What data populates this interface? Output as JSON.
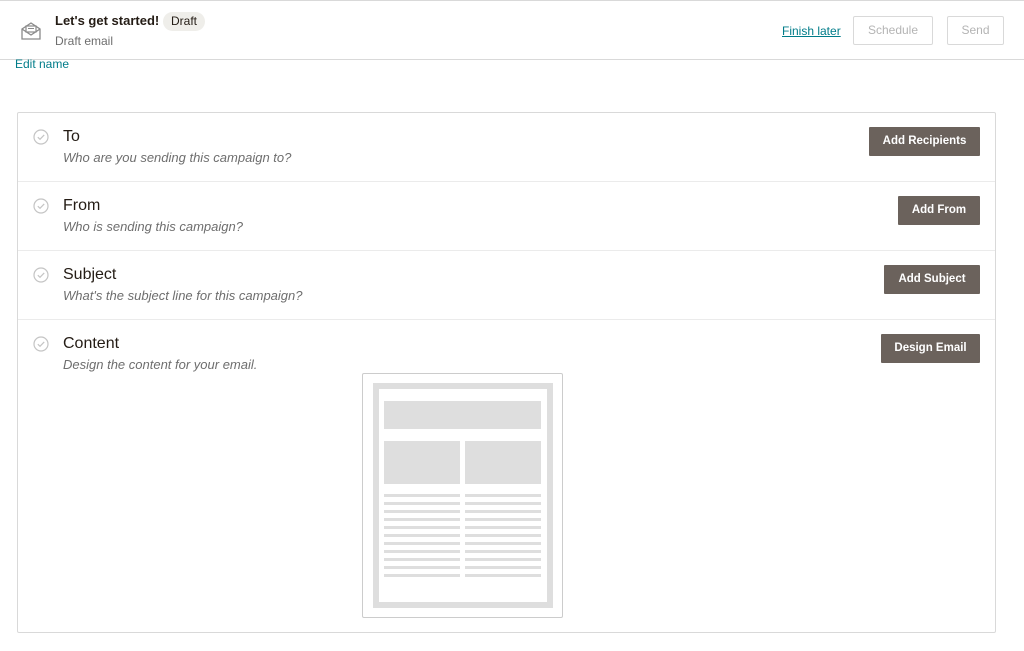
{
  "header": {
    "title": "Let's get started!",
    "status_badge": "Draft",
    "subtitle": "Draft email",
    "finish_later": "Finish later",
    "schedule": "Schedule",
    "send": "Send",
    "edit_name": "Edit name"
  },
  "checklist": {
    "items": [
      {
        "title": "To",
        "description": "Who are you sending this campaign to?",
        "button": "Add Recipients"
      },
      {
        "title": "From",
        "description": "Who is sending this campaign?",
        "button": "Add From"
      },
      {
        "title": "Subject",
        "description": "What's the subject line for this campaign?",
        "button": "Add Subject"
      },
      {
        "title": "Content",
        "description": "Design the content for your email.",
        "button": "Design Email"
      }
    ]
  },
  "colors": {
    "link": "#007c89",
    "button_bg": "#6b625c",
    "badge_bg": "#efeeea",
    "border": "#d9d9d9"
  },
  "icons": {
    "header": "envelope-icon",
    "row_status": "check-circle-icon"
  }
}
